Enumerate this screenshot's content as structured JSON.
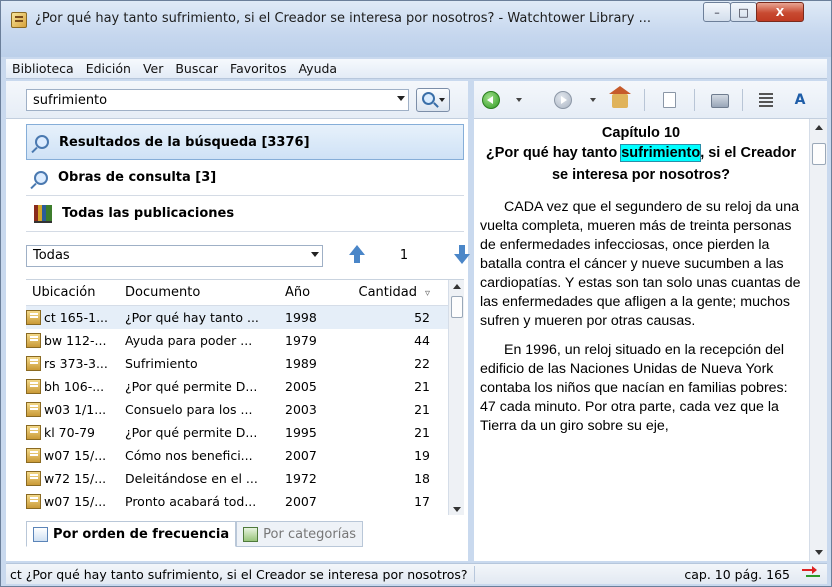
{
  "window": {
    "title": "¿Por qué hay tanto sufrimiento, si el Creador se interesa por nosotros? - Watchtower Library ...",
    "min_label": "–",
    "max_label": "□",
    "close_label": "X"
  },
  "menu": [
    "Biblioteca",
    "Edición",
    "Ver",
    "Buscar",
    "Favoritos",
    "Ayuda"
  ],
  "search": {
    "value": "sufrimiento"
  },
  "nav": {
    "results": "Resultados de la búsqueda [3376]",
    "reference": "Obras de consulta [3]",
    "all": "Todas las publicaciones"
  },
  "filter": {
    "selected": "Todas",
    "page": "1"
  },
  "table": {
    "headers": [
      "Ubicación",
      "Documento",
      "Año",
      "Cantidad"
    ],
    "rows": [
      {
        "loc": "ct 165-1...",
        "doc": "¿Por qué hay tanto ...",
        "year": "1998",
        "count": "52"
      },
      {
        "loc": "bw 112-...",
        "doc": "Ayuda para poder ...",
        "year": "1979",
        "count": "44"
      },
      {
        "loc": "rs 373-3...",
        "doc": "Sufrimiento",
        "year": "1989",
        "count": "22"
      },
      {
        "loc": "bh 106-...",
        "doc": "¿Por qué permite D...",
        "year": "2005",
        "count": "21"
      },
      {
        "loc": "w03 1/1...",
        "doc": "Consuelo para los ...",
        "year": "2003",
        "count": "21"
      },
      {
        "loc": "kl 70-79",
        "doc": "¿Por qué permite D...",
        "year": "1995",
        "count": "21"
      },
      {
        "loc": "w07 15/...",
        "doc": "Cómo nos benefici...",
        "year": "2007",
        "count": "19"
      },
      {
        "loc": "w72 15/...",
        "doc": "Deleitándose en el ...",
        "year": "1972",
        "count": "18"
      },
      {
        "loc": "w07 15/...",
        "doc": "Pronto acabará tod...",
        "year": "2007",
        "count": "17"
      }
    ]
  },
  "tabs": {
    "frequency": "Por orden de frecuencia",
    "categories": "Por categorías"
  },
  "article": {
    "chapter": "Capítulo 10",
    "title_before": "¿Por qué hay tanto ",
    "title_highlight": "sufrimiento",
    "title_after": ", si el Creador se interesa por nosotros?",
    "p1": "CADA vez que el segundero de su reloj da una vuelta completa, mueren más de treinta personas de enfermedades infecciosas, once pierden la batalla contra el cáncer y nueve sucumben a las cardiopatías. Y estas son tan solo unas cuantas de las enfermedades que afligen a la gente; muchos sufren y mueren por otras causas.",
    "p2": "En 1996, un reloj situado en la recepción del edificio de las Naciones Unidas de Nueva York contaba los niños que nacían en familias pobres: 47 cada minuto. Por otra parte, cada vez que la Tierra da un giro sobre su eje,"
  },
  "status": {
    "left": "ct ¿Por qué hay tanto sufrimiento, si el Creador se interesa por nosotros?",
    "right": "cap. 10 pág. 165"
  },
  "colors": {
    "highlight": "#00ffff",
    "selection": "#cfe2f6"
  }
}
